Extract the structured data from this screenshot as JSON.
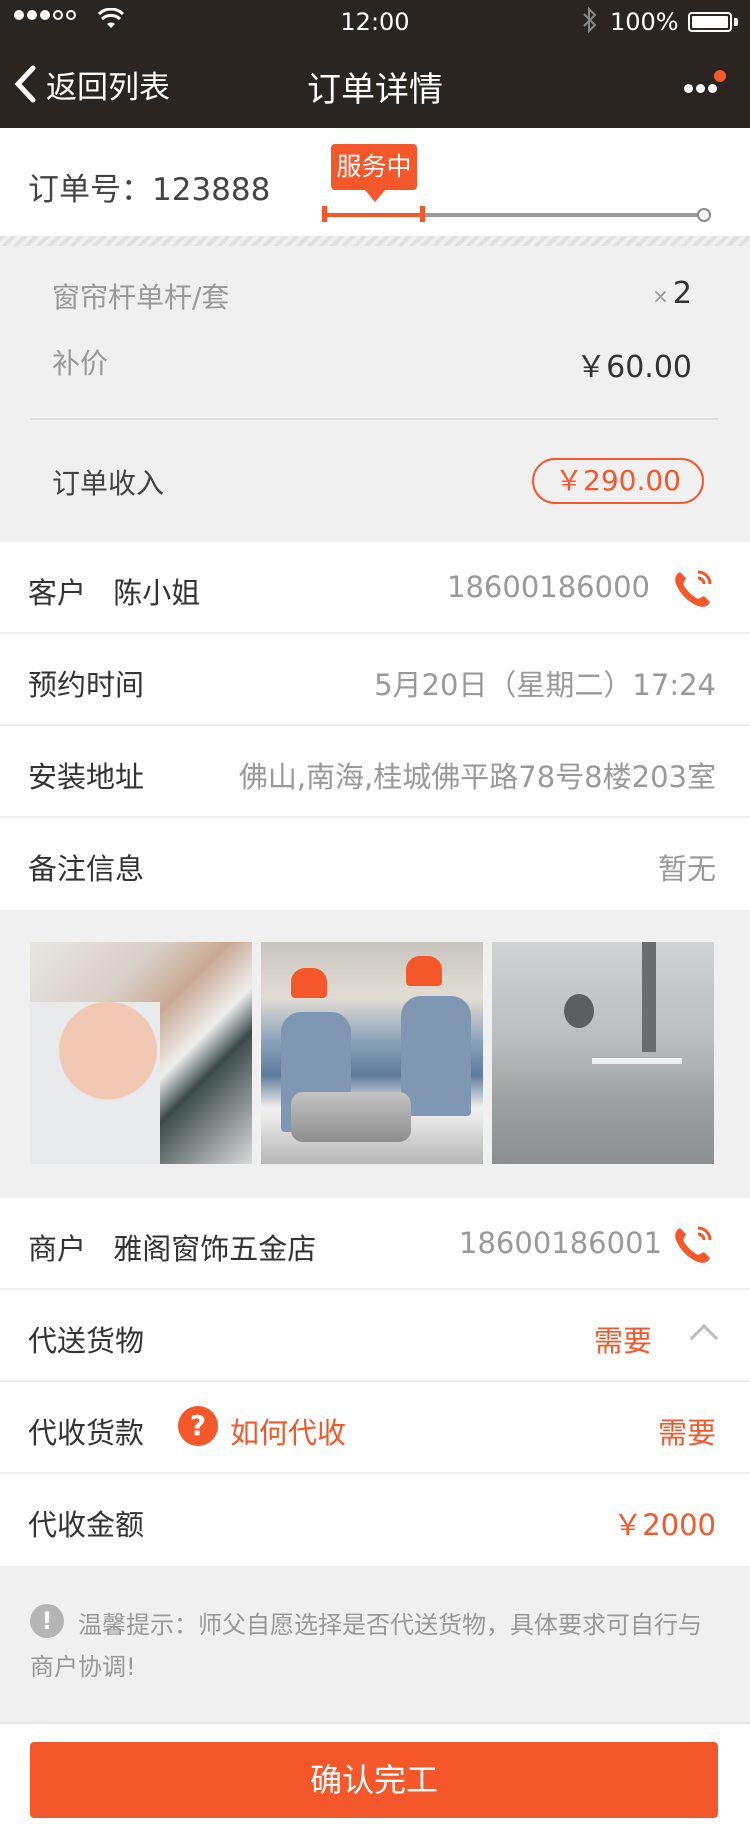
{
  "status": {
    "time": "12:00",
    "battery": "100%"
  },
  "nav": {
    "back_label": "返回列表",
    "title": "订单详情"
  },
  "order": {
    "number_label": "订单号：123888",
    "status_badge": "服务中"
  },
  "items": [
    {
      "name": "窗帘杆单杆/套",
      "qty_prefix": "×",
      "qty": "2"
    },
    {
      "name": "补价",
      "amount": "￥60.00"
    }
  ],
  "income": {
    "label": "订单收入",
    "amount": "￥290.00"
  },
  "customer": {
    "label": "客户",
    "name": "陈小姐",
    "phone": "18600186000"
  },
  "appointment": {
    "label": "预约时间",
    "value": "5月20日（星期二）17:24"
  },
  "address": {
    "label": "安装地址",
    "value": "佛山,南海,桂城佛平路78号8楼203室"
  },
  "remarks": {
    "label": "备注信息",
    "value": "暂无"
  },
  "merchant": {
    "label": "商户",
    "name": "雅阁窗饰五金店",
    "phone": "18600186001"
  },
  "delivery": {
    "label": "代送货物",
    "value": "需要"
  },
  "collection": {
    "label": "代收货款",
    "help_link": "如何代收",
    "value": "需要"
  },
  "collection_amount": {
    "label": "代收金额",
    "value": "￥2000"
  },
  "tip": {
    "text": "温馨提示：师父自愿选择是否代送货物，具体要求可自行与商户协调!"
  },
  "actions": {
    "confirm_label": "确认完工"
  },
  "colors": {
    "accent": "#f4572a",
    "navbar": "#2b2521"
  },
  "icons": [
    "chevron-left-icon",
    "more-icon",
    "phone-icon",
    "help-icon",
    "chevron-up-icon",
    "exclamation-icon",
    "wifi-icon",
    "bluetooth-icon",
    "battery-icon"
  ]
}
